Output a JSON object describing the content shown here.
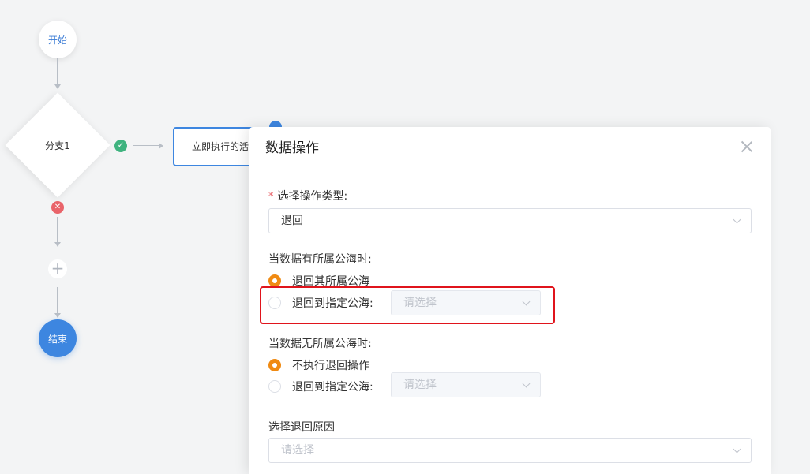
{
  "flow": {
    "start_label": "开始",
    "branch_label": "分支1",
    "activity_label": "立即执行的活动",
    "end_label": "结束",
    "add_symbol": "+",
    "success_symbol": "✓",
    "fail_symbol": "✕"
  },
  "drawer": {
    "title": "数据操作",
    "operation_type": {
      "label": "选择操作类型:",
      "required_mark": "*",
      "value": "退回"
    },
    "has_sea": {
      "label": "当数据有所属公海时:",
      "options": [
        {
          "label": "退回其所属公海",
          "checked": true
        },
        {
          "label": "退回到指定公海:",
          "checked": false,
          "select_placeholder": "请选择"
        }
      ]
    },
    "no_sea": {
      "label": "当数据无所属公海时:",
      "options": [
        {
          "label": "不执行退回操作",
          "checked": true
        },
        {
          "label": "退回到指定公海:",
          "checked": false,
          "select_placeholder": "请选择"
        }
      ]
    },
    "reason": {
      "label": "选择退回原因",
      "placeholder": "请选择"
    }
  },
  "colors": {
    "primary": "#3d86e0",
    "success": "#3fb37f",
    "danger": "#e9646a",
    "radio_checked": "#f08a12",
    "highlight": "#e0141c"
  }
}
